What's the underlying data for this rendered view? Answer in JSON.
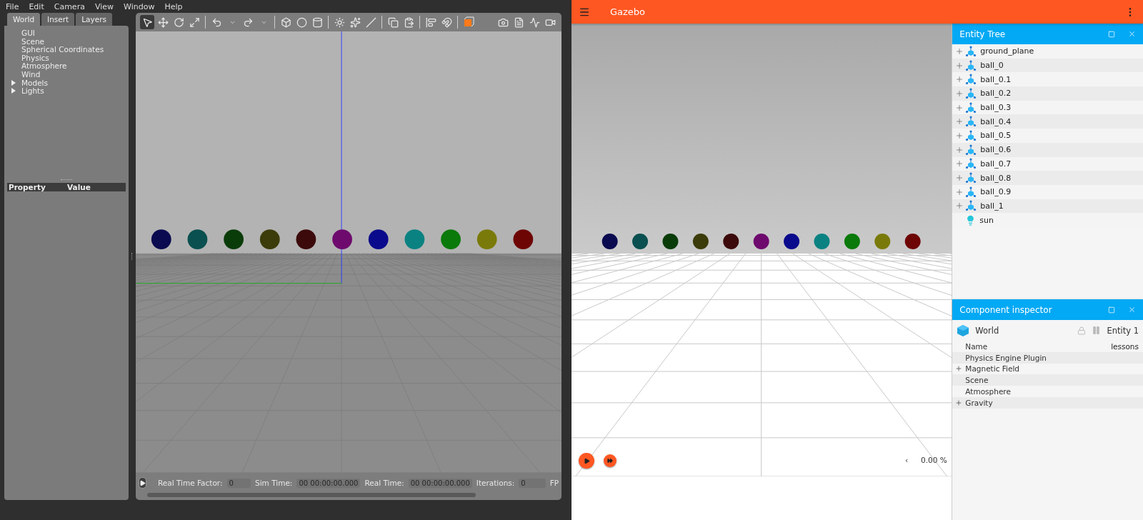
{
  "left_app": {
    "menu": [
      "File",
      "Edit",
      "Camera",
      "View",
      "Window",
      "Help"
    ],
    "tabs": [
      {
        "label": "World",
        "selected": true
      },
      {
        "label": "Insert",
        "selected": false
      },
      {
        "label": "Layers",
        "selected": false
      }
    ],
    "world_tree": [
      {
        "label": "GUI"
      },
      {
        "label": "Scene"
      },
      {
        "label": "Spherical Coordinates"
      },
      {
        "label": "Physics"
      },
      {
        "label": "Atmosphere"
      },
      {
        "label": "Wind"
      },
      {
        "label": "Models",
        "expanded": false
      },
      {
        "label": "Lights",
        "expanded": false
      }
    ],
    "property_table": {
      "columns": [
        "Property",
        "Value"
      ]
    },
    "status_bar": {
      "fields": [
        {
          "label": "Real Time Factor:",
          "value": "0"
        },
        {
          "label": "Sim Time:",
          "value": "00 00:00:00.000"
        },
        {
          "label": "Real Time:",
          "value": "00 00:00:00.000"
        },
        {
          "label": "Iterations:",
          "value": "0"
        }
      ],
      "cut_label": "FP"
    }
  },
  "right_app": {
    "title": "Gazebo",
    "entity_tree": {
      "title": "Entity Tree",
      "items": [
        {
          "label": "ground_plane",
          "kind": "model"
        },
        {
          "label": "ball_0",
          "kind": "model"
        },
        {
          "label": "ball_0.1",
          "kind": "model"
        },
        {
          "label": "ball_0.2",
          "kind": "model"
        },
        {
          "label": "ball_0.3",
          "kind": "model"
        },
        {
          "label": "ball_0.4",
          "kind": "model"
        },
        {
          "label": "ball_0.5",
          "kind": "model"
        },
        {
          "label": "ball_0.6",
          "kind": "model"
        },
        {
          "label": "ball_0.7",
          "kind": "model"
        },
        {
          "label": "ball_0.8",
          "kind": "model"
        },
        {
          "label": "ball_0.9",
          "kind": "model"
        },
        {
          "label": "ball_1",
          "kind": "model"
        },
        {
          "label": "sun",
          "kind": "light"
        }
      ]
    },
    "inspector": {
      "title": "Component inspector",
      "entity": "World",
      "entity_id": "Entity 1",
      "rows": [
        {
          "label": "Name",
          "value": "lessons",
          "expandable": false
        },
        {
          "label": "Physics Engine Plugin",
          "expandable": false
        },
        {
          "label": "Magnetic Field",
          "expandable": true
        },
        {
          "label": "Scene",
          "expandable": false
        },
        {
          "label": "Atmosphere",
          "expandable": false
        },
        {
          "label": "Gravity",
          "expandable": true
        }
      ]
    },
    "playback": {
      "back": "‹",
      "rtf": "0.00 %"
    }
  }
}
